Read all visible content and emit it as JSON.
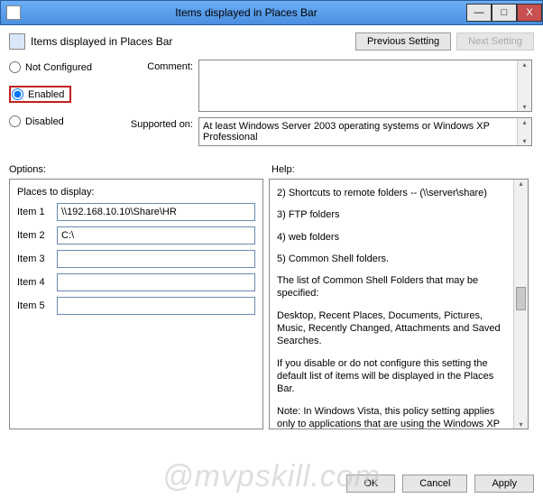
{
  "window": {
    "title": "Items displayed in Places Bar",
    "minimize": "—",
    "maximize": "□",
    "close": "X"
  },
  "header": {
    "title": "Items displayed in Places Bar",
    "prev": "Previous Setting",
    "next": "Next Setting"
  },
  "radios": {
    "not_configured": "Not Configured",
    "enabled": "Enabled",
    "disabled": "Disabled"
  },
  "labels": {
    "comment": "Comment:",
    "supported": "Supported on:",
    "options": "Options:",
    "help": "Help:"
  },
  "supported_text": "At least Windows Server 2003 operating systems or Windows XP Professional",
  "places": {
    "heading": "Places to display:",
    "items": [
      {
        "label": "Item 1",
        "value": "\\\\192.168.10.10\\Share\\HR"
      },
      {
        "label": "Item 2",
        "value": "C:\\"
      },
      {
        "label": "Item 3",
        "value": ""
      },
      {
        "label": "Item 4",
        "value": ""
      },
      {
        "label": "Item 5",
        "value": ""
      }
    ]
  },
  "help_lines": {
    "l2": "2) Shortcuts to remote folders -- (\\\\server\\share)",
    "l3": "3) FTP folders",
    "l4": "4) web folders",
    "l5": "5) Common Shell folders.",
    "p1": "The list of Common Shell Folders that may be specified:",
    "p2": "Desktop, Recent Places, Documents, Pictures, Music, Recently Changed, Attachments and Saved Searches.",
    "p3": "If you disable or do not configure this setting the default list of items will be displayed in the Places Bar.",
    "p4": "Note: In Windows Vista, this policy  setting applies only to applications that are using the Windows XP common dialog box style. This policy setting does not apply to the new Windows Vista common dialog box style."
  },
  "footer": {
    "ok": "OK",
    "cancel": "Cancel",
    "apply": "Apply"
  },
  "watermark": "@mvpskill.com"
}
